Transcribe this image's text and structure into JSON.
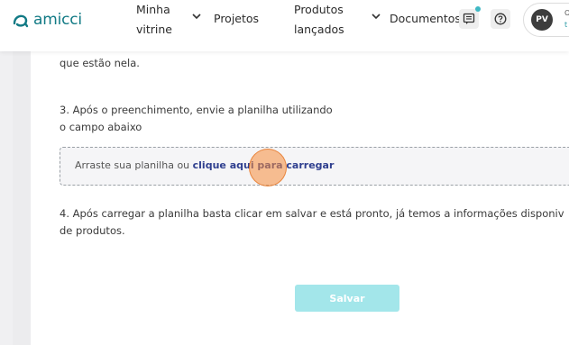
{
  "header": {
    "logo_text": "amicci",
    "nav": {
      "vitrine_line1": "Minha",
      "vitrine_line2": "vitrine",
      "projetos": "Projetos",
      "produtos_line1": "Produtos",
      "produtos_line2": "lançados",
      "documentos": "Documentos"
    },
    "profile": {
      "initials": "PV",
      "line1": "O",
      "line2": "t"
    }
  },
  "content": {
    "cut_text": "que estão nela.",
    "step3_line1": "3. Após o preenchimento, envie a planilha utilizando",
    "step3_line2": "o campo abaixo",
    "dropzone": {
      "prefix": "Arraste sua planilha ou ",
      "link": "clique aqui para carregar"
    },
    "step4_line1": "4. Após carregar a planilha basta clicar em salvar e está pronto, já temos a informações disponiv",
    "step4_line2": "de produtos.",
    "save_label": "Salvar"
  },
  "colors": {
    "brand": "#127a85",
    "save_button": "#a3e6ea",
    "link": "#2f3f8f",
    "notification": "#3fb8c4"
  },
  "icons": {
    "logo": "amicci-logo-icon",
    "chevrons": "chevron-down-icon",
    "messages": "message-icon",
    "help": "help-circle-icon"
  }
}
